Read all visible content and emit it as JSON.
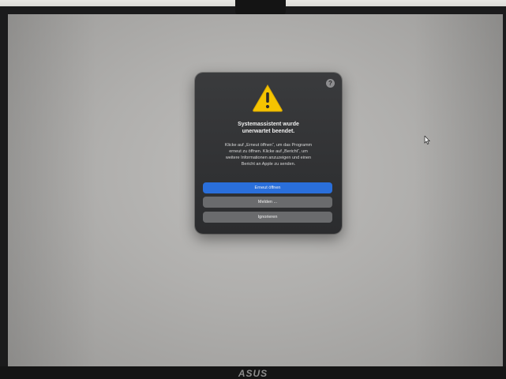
{
  "monitor": {
    "brand": "ASUS"
  },
  "dialog": {
    "title_line1": "Systemassistent wurde",
    "title_line2": "unerwartet beendet.",
    "message_line1": "Klicke auf „Erneut öffnen“, um das Programm",
    "message_line2": "erneut zu öffnen. Klicke auf „Bericht“, um",
    "message_line3": "weitere Informationen anzuzeigen und einen",
    "message_line4": "Bericht an Apple zu senden.",
    "help_label": "?",
    "buttons": {
      "reopen_label": "Erneut öffnen",
      "report_label": "Melden ...",
      "ignore_label": "Ignorieren"
    }
  },
  "icons": {
    "warning": "warning-icon",
    "help": "help-icon",
    "cursor": "cursor-icon"
  },
  "colors": {
    "dialog_bg": "#2b2c2e",
    "primary_button": "#2a6fdb",
    "secondary_button": "#6a6b6d",
    "warning_yellow": "#f5c400"
  }
}
